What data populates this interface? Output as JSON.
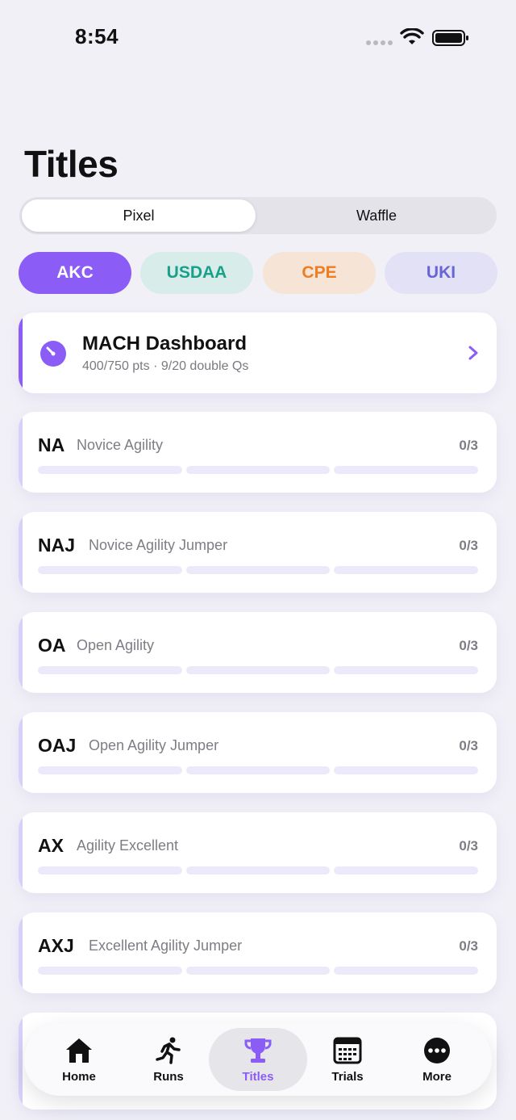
{
  "status_bar": {
    "time": "8:54"
  },
  "page": {
    "title": "Titles"
  },
  "segmented": {
    "options": [
      "Pixel",
      "Waffle"
    ],
    "selected": "Pixel"
  },
  "orgs": [
    {
      "label": "AKC",
      "selected": true,
      "color": "#8b5cf6"
    },
    {
      "label": "USDAA",
      "selected": false,
      "color": "#17a18b"
    },
    {
      "label": "CPE",
      "selected": false,
      "color": "#ef7d22"
    },
    {
      "label": "UKI",
      "selected": false,
      "color": "#6764d8"
    }
  ],
  "mach": {
    "title": "MACH Dashboard",
    "subtitle": "400/750 pts · 9/20 double Qs"
  },
  "titles": [
    {
      "abbr": "NA",
      "name": "Novice Agility",
      "count": "0/3",
      "progress": 0
    },
    {
      "abbr": "NAJ",
      "name": "Novice Agility Jumper",
      "count": "0/3",
      "progress": 0
    },
    {
      "abbr": "OA",
      "name": "Open Agility",
      "count": "0/3",
      "progress": 0
    },
    {
      "abbr": "OAJ",
      "name": "Open Agility Jumper",
      "count": "0/3",
      "progress": 0
    },
    {
      "abbr": "AX",
      "name": "Agility Excellent",
      "count": "0/3",
      "progress": 0
    },
    {
      "abbr": "AXJ",
      "name": "Excellent Agility Jumper",
      "count": "0/3",
      "progress": 0
    }
  ],
  "tabs": [
    {
      "label": "Home",
      "icon": "home-icon"
    },
    {
      "label": "Runs",
      "icon": "runner-icon"
    },
    {
      "label": "Titles",
      "icon": "trophy-icon",
      "active": true
    },
    {
      "label": "Trials",
      "icon": "calendar-icon"
    },
    {
      "label": "More",
      "icon": "more-icon"
    }
  ],
  "colors": {
    "accent": "#8b5cf6",
    "background": "#f1f0f7"
  }
}
